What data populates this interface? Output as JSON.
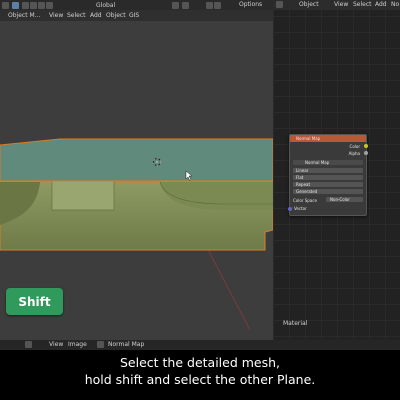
{
  "viewport_header": {
    "mode_label": "Object M...",
    "menus": [
      "View",
      "Select",
      "Add",
      "Object",
      "GIS"
    ],
    "transform_orientation": "Global",
    "options_label": "Options"
  },
  "node_editor_header": {
    "type_label": "Object",
    "menus": [
      "View",
      "Select",
      "Add",
      "No"
    ]
  },
  "node": {
    "title": "Normal Map",
    "outputs": [
      "Color",
      "Alpha"
    ],
    "image_name": "Normal Map",
    "fields": [
      "Linear",
      "Flat",
      "Repeat",
      "Generated"
    ],
    "color_space_label": "Color Space",
    "color_space_value": "Non-Color",
    "vector_label": "Vector",
    "socket_colors": {
      "color": "#c7c729",
      "alpha": "#a1a1a1",
      "vector": "#6363c7"
    }
  },
  "material_label": "Material",
  "bottom_bar": {
    "menus": [
      "View",
      "Image"
    ],
    "image_name": "Normal Map"
  },
  "shift_badge": "Shift",
  "caption": {
    "line1": "Select the detailed mesh,",
    "line2": "hold shift and select the other Plane."
  },
  "colors": {
    "plane_fill": "#5f8a7c",
    "mesh_fill": "#8d9a63",
    "selection_outline": "#e07a24",
    "badge": "#2f9a5c",
    "node_header": "#b8573a"
  }
}
